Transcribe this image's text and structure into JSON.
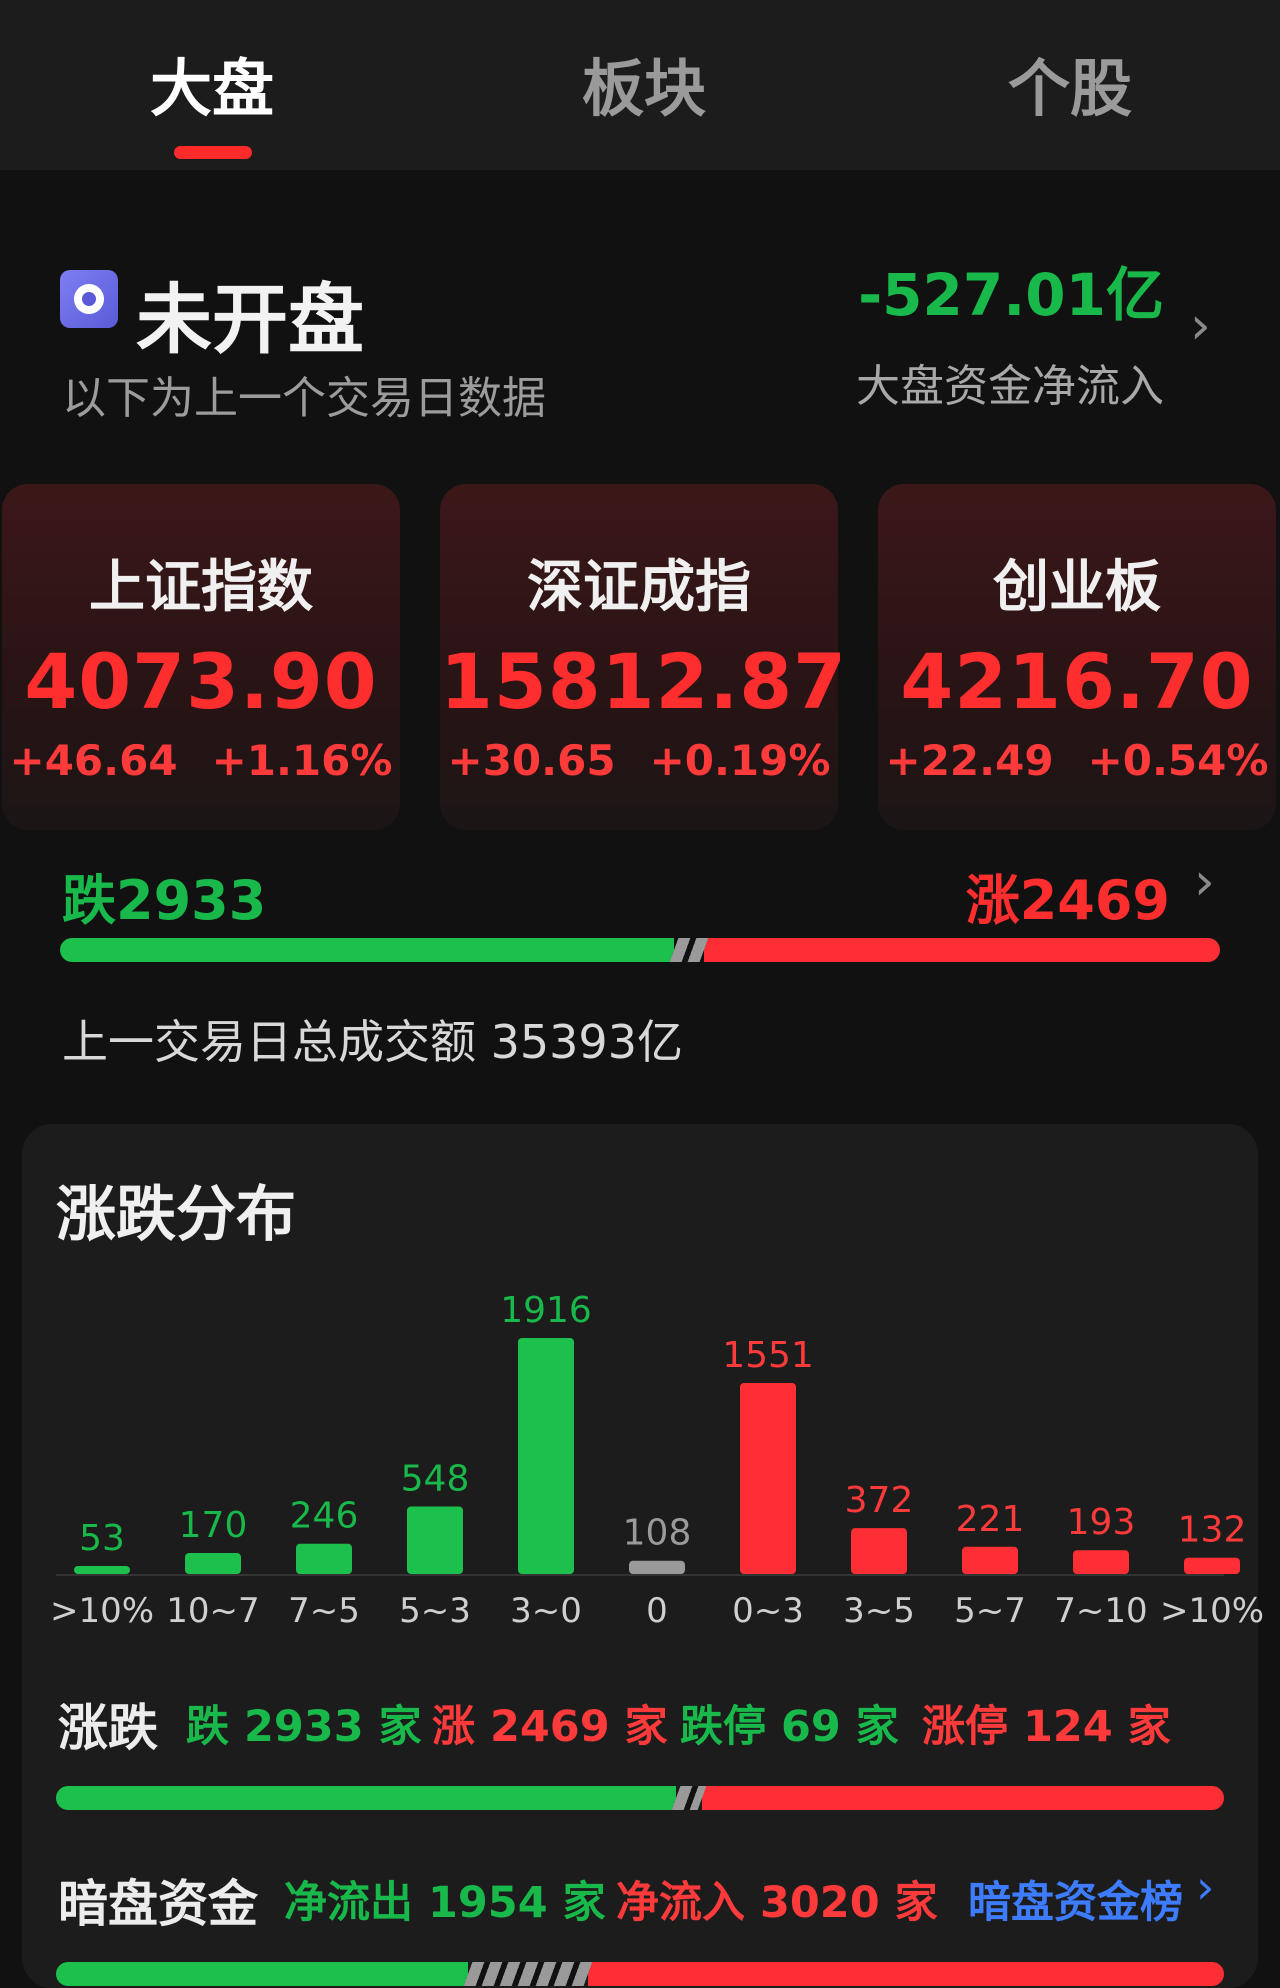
{
  "tabs": [
    {
      "label": "大盘",
      "active": true
    },
    {
      "label": "板块",
      "active": false
    },
    {
      "label": "个股",
      "active": false
    }
  ],
  "market_status": {
    "title": "未开盘",
    "subtitle": "以下为上一个交易日数据",
    "net_flow_value": "-527.01亿",
    "net_flow_label": "大盘资金净流入"
  },
  "indices": [
    {
      "name": "上证指数",
      "value": "4073.90",
      "change": "+46.64",
      "pct": "+1.16%"
    },
    {
      "name": "深证成指",
      "value": "15812.87",
      "change": "+30.65",
      "pct": "+0.19%"
    },
    {
      "name": "创业板",
      "value": "4216.70",
      "change": "+22.49",
      "pct": "+0.54%"
    }
  ],
  "breadth": {
    "fall_label": "跌2933",
    "rise_label": "涨2469",
    "fall": 2933,
    "flat": 108,
    "rise": 2469
  },
  "turnover_text": "上一交易日总成交额 35393亿",
  "distribution": {
    "title": "涨跌分布"
  },
  "chart_data": {
    "type": "bar",
    "title": "涨跌分布",
    "categories": [
      ">10%",
      "10~7",
      "7~5",
      "5~3",
      "3~0",
      "0",
      "0~3",
      "3~5",
      "5~7",
      "7~10",
      ">10%"
    ],
    "values": [
      53,
      170,
      246,
      548,
      1916,
      108,
      1551,
      372,
      221,
      193,
      132
    ],
    "bar_colors": [
      "#1dbf4d",
      "#1dbf4d",
      "#1dbf4d",
      "#1dbf4d",
      "#1dbf4d",
      "#9a9a9a",
      "#ff2e35",
      "#ff2e35",
      "#ff2e35",
      "#ff2e35",
      "#ff2e35"
    ],
    "label_colors": [
      "#19b84a",
      "#19b84a",
      "#19b84a",
      "#19b84a",
      "#19b84a",
      "#9a9a9a",
      "#ff3a3a",
      "#ff3a3a",
      "#ff3a3a",
      "#ff3a3a",
      "#ff3a3a"
    ],
    "ylim": [
      0,
      1916
    ],
    "xlabel": "",
    "ylabel": "",
    "grid": false,
    "legend": "none"
  },
  "updown_row": {
    "label": "涨跌",
    "fall": "跌 2933 家",
    "rise": "涨 2469 家",
    "limit_down": "跌停 69 家",
    "limit_up": "涨停 124 家"
  },
  "dark_pool": {
    "label": "暗盘资金",
    "outflow": "净流出 1954 家",
    "inflow": "净流入 3020 家",
    "rank_link": "暗盘资金榜",
    "outflow_count": 1954,
    "inflow_count": 3020
  },
  "colors": {
    "up": "#ff2e35",
    "down": "#1dbf4d",
    "flat": "#9a9a9a",
    "link": "#3d7bff",
    "tab_indicator": "#ff2a2a"
  }
}
